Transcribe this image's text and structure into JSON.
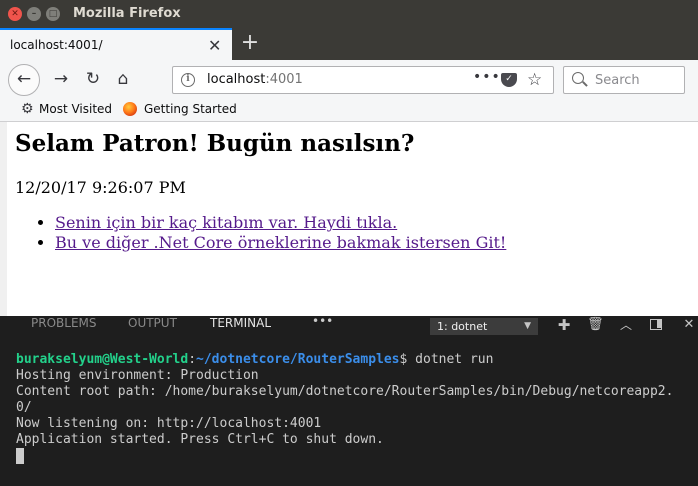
{
  "window": {
    "title": "Mozilla Firefox"
  },
  "tabs": [
    {
      "title": "localhost:4001/"
    }
  ],
  "navbar": {
    "url_host": "localhost",
    "url_port": ":4001",
    "search_placeholder": "Search"
  },
  "bookmarks": [
    {
      "label": "Most Visited",
      "icon": "gear-icon"
    },
    {
      "label": "Getting Started",
      "icon": "firefox-icon"
    }
  ],
  "page": {
    "heading": "Selam Patron! Bugün nasılsın?",
    "datetime": "12/20/17 9:26:07 PM",
    "links": [
      "Senin için bir kaç kitabım var. Haydi tıkla.",
      "Bu ve diğer .Net Core örneklerine bakmak istersen Git!"
    ],
    "link_color": "#551a8b"
  },
  "panel": {
    "tabs": [
      "PROBLEMS",
      "OUTPUT",
      "TERMINAL"
    ],
    "active_tab": "TERMINAL",
    "terminal_select": "1: dotnet"
  },
  "terminal": {
    "prompt_user": "burakselyum@West-World",
    "prompt_colon": ":",
    "prompt_path": "~/dotnetcore/RouterSamples",
    "prompt_command": "$ dotnet run",
    "output": [
      "Hosting environment: Production",
      "Content root path: /home/burakselyum/dotnetcore/RouterSamples/bin/Debug/netcoreapp2.",
      "0/",
      "Now listening on: http://localhost:4001",
      "Application started. Press Ctrl+C to shut down."
    ],
    "colors": {
      "user": "#23d18b",
      "path": "#3b8eea",
      "text": "#cccccc"
    }
  }
}
